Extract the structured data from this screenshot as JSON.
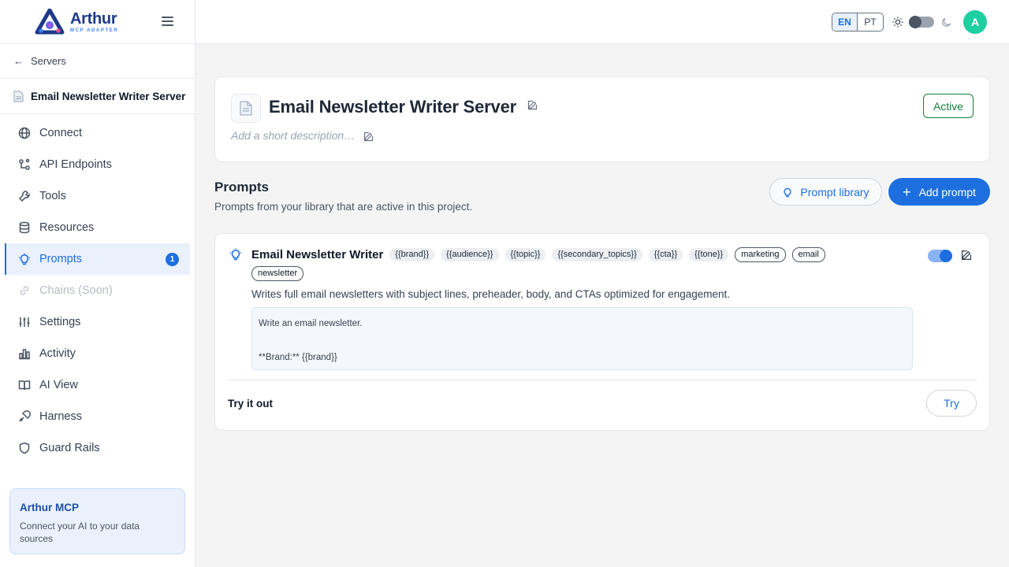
{
  "brand": {
    "name": "Arthur",
    "sub": "MCP ADAPTER"
  },
  "sidebar": {
    "back_label": "Servers",
    "server_name": "Email Newsletter Writer Server",
    "items": [
      {
        "label": "Connect",
        "icon": "globe-icon"
      },
      {
        "label": "API Endpoints",
        "icon": "api-icon"
      },
      {
        "label": "Tools",
        "icon": "wrench-icon"
      },
      {
        "label": "Resources",
        "icon": "database-icon"
      },
      {
        "label": "Prompts",
        "icon": "lightbulb-icon",
        "badge": "1",
        "active": true
      },
      {
        "label": "Chains (Soon)",
        "icon": "link-icon",
        "disabled": true
      },
      {
        "label": "Settings",
        "icon": "sliders-icon"
      },
      {
        "label": "Activity",
        "icon": "bar-chart-icon"
      },
      {
        "label": "AI View",
        "icon": "book-icon"
      },
      {
        "label": "Harness",
        "icon": "harness-icon"
      },
      {
        "label": "Guard Rails",
        "icon": "shield-icon"
      }
    ],
    "promo": {
      "title": "Arthur MCP",
      "text": "Connect your AI to your data sources"
    }
  },
  "header": {
    "lang_en": "EN",
    "lang_pt": "PT",
    "avatar_initial": "A"
  },
  "main": {
    "title": "Email Newsletter Writer Server",
    "description_placeholder": "Add a short description…",
    "status": "Active",
    "section_title": "Prompts",
    "section_subtitle": "Prompts from your library that are active in this project.",
    "library_button": "Prompt library",
    "add_button": "Add prompt",
    "prompt": {
      "name": "Email Newsletter Writer",
      "variables": [
        "{{brand}}",
        "{{audience}}",
        "{{topic}}",
        "{{secondary_topics}}",
        "{{cta}}",
        "{{tone}}"
      ],
      "tags": [
        "marketing",
        "email",
        "newsletter"
      ],
      "description": "Writes full email newsletters with subject lines, preheader, body, and CTAs optimized for engagement.",
      "enabled": true,
      "preview_line1": "Write an email newsletter.",
      "preview_line2": "**Brand:** {{brand}}",
      "try_label": "Try it out",
      "try_button": "Try"
    }
  },
  "colors": {
    "accent": "#1d6fe0",
    "active_status": "#15803d",
    "avatar": "#1ecfa1"
  }
}
